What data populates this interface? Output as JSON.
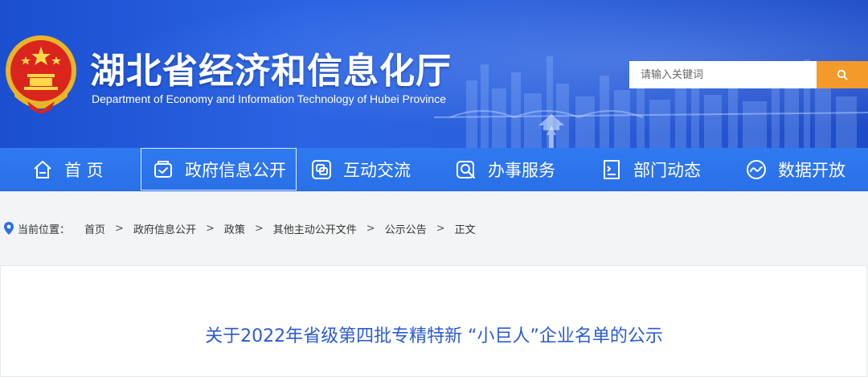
{
  "header": {
    "title": "湖北省经济和信息化厅",
    "subtitle": "Department of Economy and Information Technology of Hubei Province",
    "search_placeholder": "请输入关键词"
  },
  "nav": {
    "items": [
      {
        "label": "首 页",
        "icon": "home-icon"
      },
      {
        "label": "政府信息公开",
        "icon": "document-check-icon"
      },
      {
        "label": "互动交流",
        "icon": "chat-icon"
      },
      {
        "label": "办事服务",
        "icon": "service-search-icon"
      },
      {
        "label": "部门动态",
        "icon": "news-icon"
      },
      {
        "label": "数据开放",
        "icon": "data-wave-icon"
      }
    ],
    "active_index": 1
  },
  "breadcrumb": {
    "label": "当前位置：",
    "items": [
      "首页",
      "政府信息公开",
      "政策",
      "其他主动公开文件",
      "公示公告",
      "正文"
    ],
    "separator": ">"
  },
  "document": {
    "title": "关于2022年省级第四批专精特新 “小巨人”企业名单的公示"
  },
  "colors": {
    "header_blue": "#2a63e3",
    "nav_blue": "#2f7af0",
    "search_button": "#f39a2a",
    "title_blue": "#2b5bd0"
  }
}
